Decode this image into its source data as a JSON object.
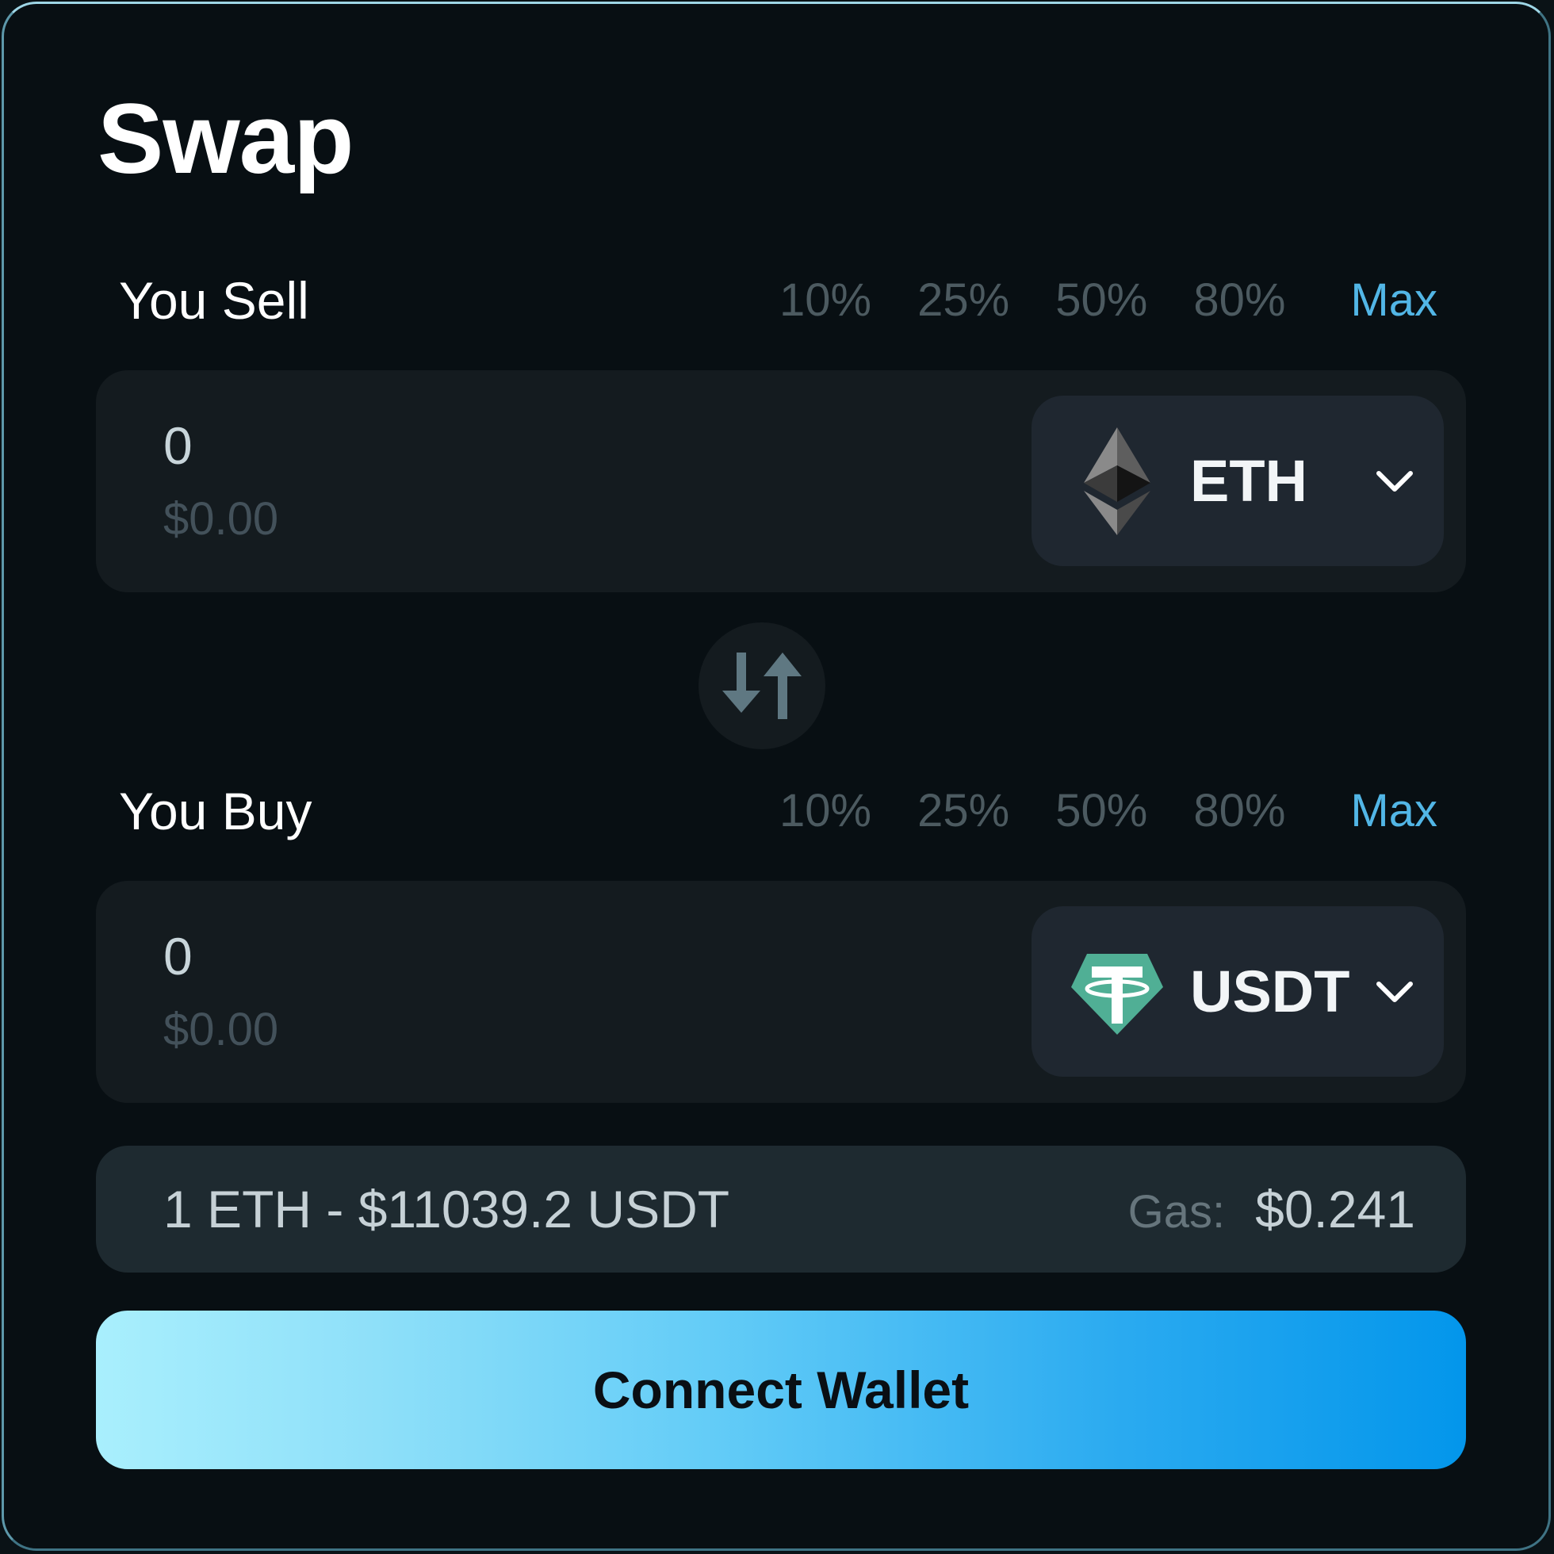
{
  "title": "Swap",
  "sell": {
    "label": "You Sell",
    "percents": [
      "10%",
      "25%",
      "50%",
      "80%"
    ],
    "max_label": "Max",
    "amount": "0",
    "usd": "$0.00",
    "token": {
      "symbol": "ETH",
      "icon": "ethereum-icon"
    }
  },
  "buy": {
    "label": "You Buy",
    "percents": [
      "10%",
      "25%",
      "50%",
      "80%"
    ],
    "max_label": "Max",
    "amount": "0",
    "usd": "$0.00",
    "token": {
      "symbol": "USDT",
      "icon": "tether-icon"
    }
  },
  "rate": {
    "text": "1 ETH - $11039.2 USDT",
    "gas_label": "Gas:",
    "gas_value": "$0.241"
  },
  "connect_button": {
    "label": "Connect Wallet"
  },
  "colors": {
    "accent": "#52b6e6",
    "tether_green": "#50af95",
    "button_gradient_start": "#a9effd",
    "button_gradient_end": "#0396eb"
  }
}
